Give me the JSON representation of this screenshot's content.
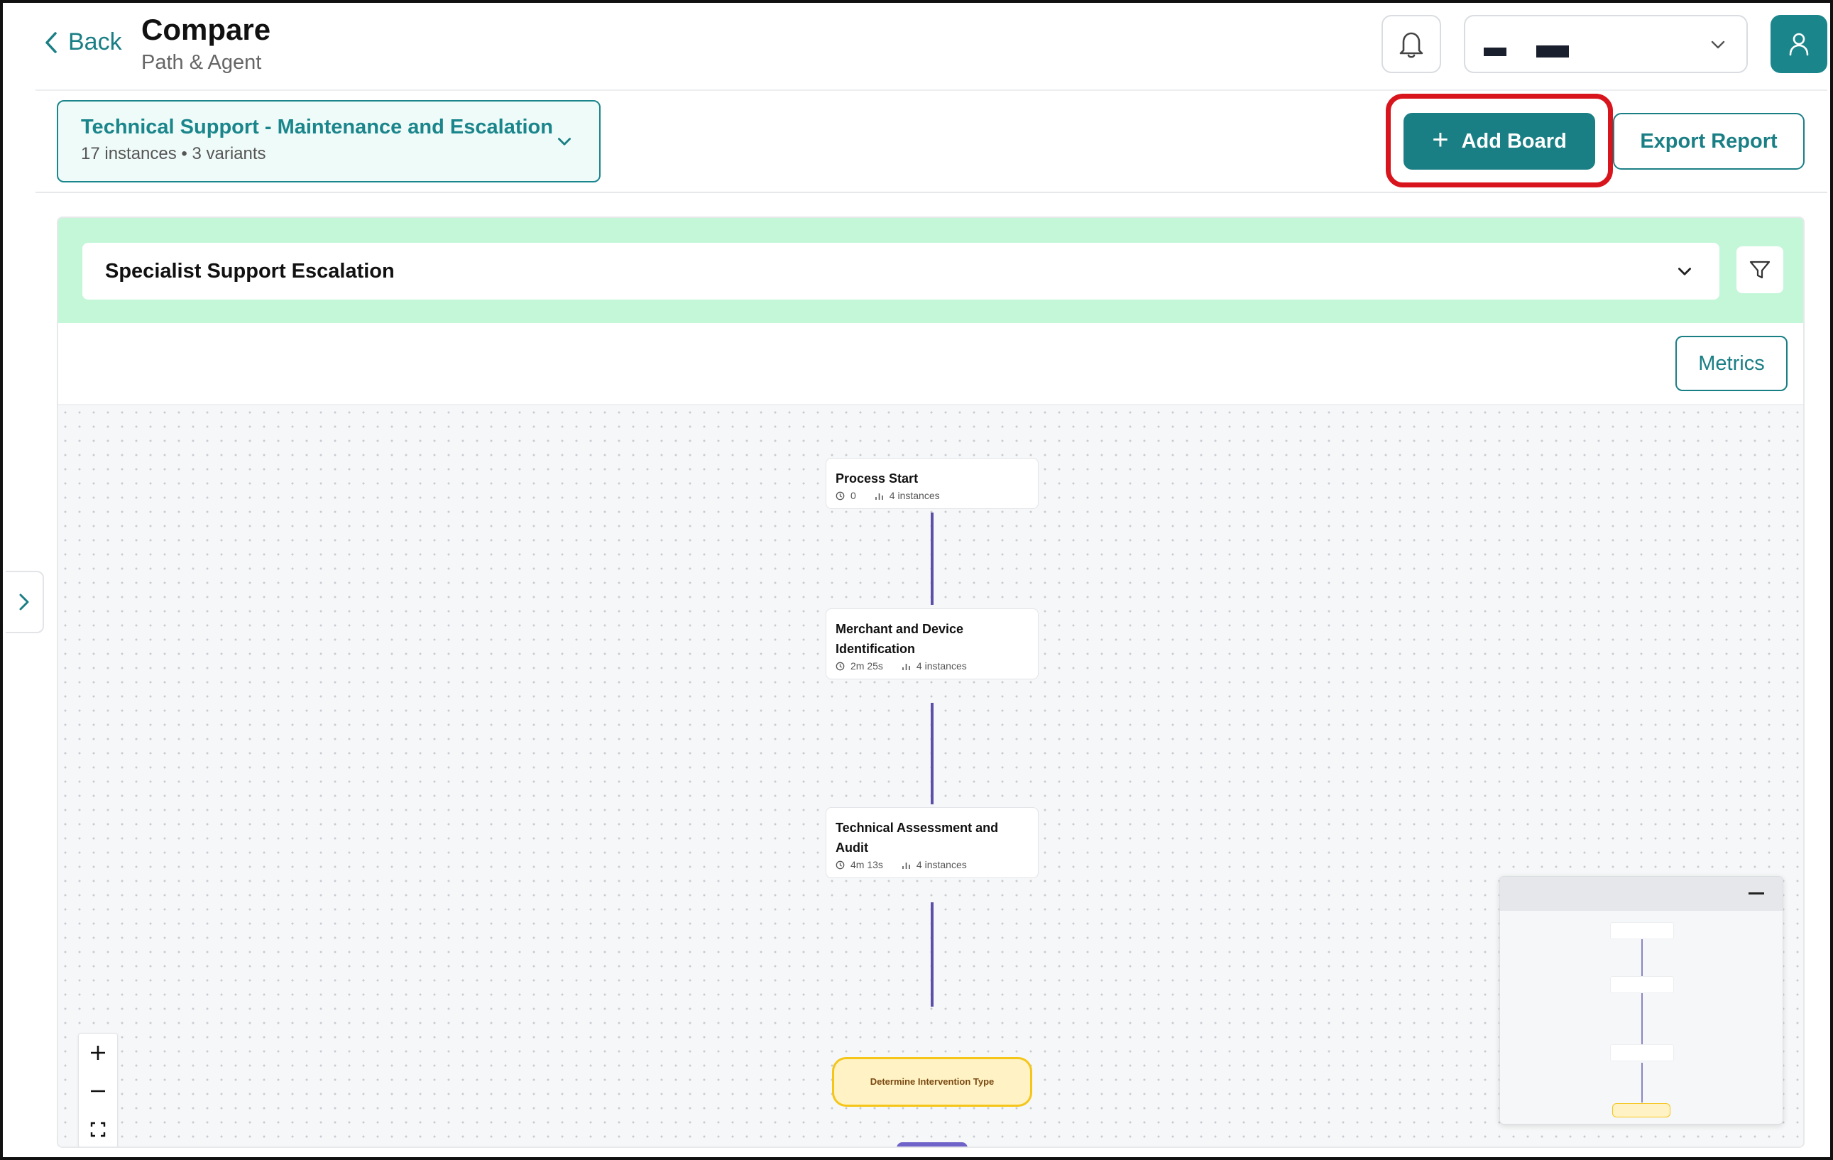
{
  "header": {
    "back_label": "Back",
    "title": "Compare",
    "subtitle": "Path & Agent"
  },
  "process": {
    "name": "Technical Support - Maintenance and Escalation",
    "meta": "17 instances • 3 variants"
  },
  "actions": {
    "add_board": "Add Board",
    "export_report": "Export Report"
  },
  "board": {
    "variant": "Specialist Support Escalation",
    "metrics_label": "Metrics",
    "nodes": [
      {
        "title": "Process Start",
        "duration": "0",
        "instances": "4 instances"
      },
      {
        "title": "Merchant and Device Identification",
        "duration": "2m 25s",
        "instances": "4 instances"
      },
      {
        "title": "Technical Assessment and Audit",
        "duration": "4m 13s",
        "instances": "4 instances"
      }
    ],
    "decision": "Determine Intervention Type"
  },
  "icons": {
    "back": "chevron-left-icon",
    "notifications": "bell-icon",
    "account_dropdown": "chevron-down-icon",
    "user": "user-icon",
    "filter": "filter-icon",
    "zoom_in": "plus-icon",
    "zoom_out": "minus-icon",
    "fit_view": "fit-view-icon",
    "sidebar_toggle": "chevron-right-icon"
  },
  "colors": {
    "accent": "#1a7f85",
    "highlight": "#d8141c",
    "board_header": "#c4f6d8",
    "edge": "#5b4fa8",
    "decision_fill": "#fff2c4",
    "decision_border": "#f5c518"
  }
}
